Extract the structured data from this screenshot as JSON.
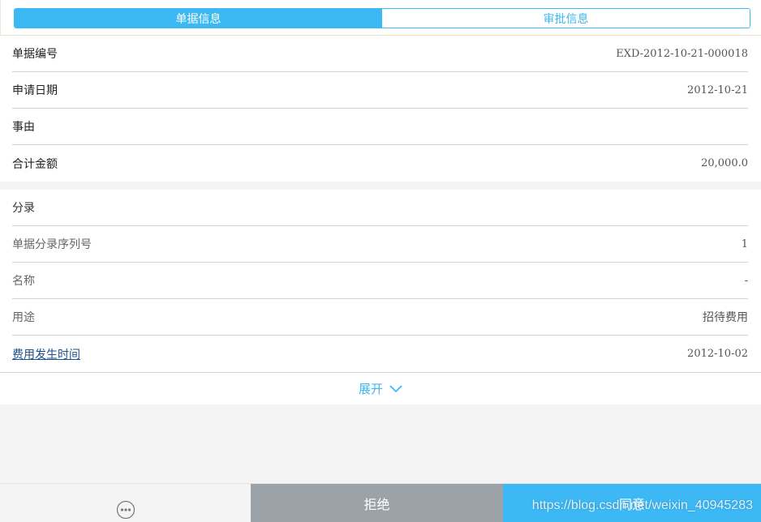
{
  "tabs": [
    {
      "label": "单据信息",
      "active": true
    },
    {
      "label": "审批信息",
      "active": false
    }
  ],
  "header_fields": [
    {
      "label": "单据编号",
      "value": "EXD-2012-10-21-000018"
    },
    {
      "label": "申请日期",
      "value": "2012-10-21"
    },
    {
      "label": "事由",
      "value": ""
    },
    {
      "label": "合计金额",
      "value": "20,000.0"
    }
  ],
  "entry": {
    "title": "分录",
    "fields": [
      {
        "label": "单据分录序列号",
        "value": "1"
      },
      {
        "label": "名称",
        "value": "-"
      },
      {
        "label": "用途",
        "value": "招待费用"
      },
      {
        "label": "费用发生时间",
        "value": "2012-10-02"
      }
    ],
    "expand_label": "展开"
  },
  "actions": {
    "reject_label": "拒绝",
    "agree_label": "同意"
  },
  "watermark": "https://blog.csdn.net/weixin_40945283",
  "colors": {
    "accent": "#3cb8f5",
    "reject": "#9ba2a8",
    "link": "#1d4f8a"
  },
  "icons": {
    "more": "more-dots-icon",
    "expand": "chevron-down-icon"
  }
}
